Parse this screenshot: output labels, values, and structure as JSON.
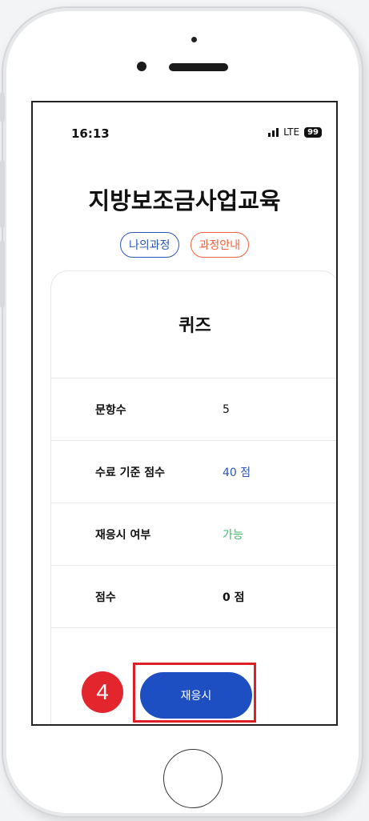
{
  "status_bar": {
    "time": "16:13",
    "network": "LTE",
    "battery": "99"
  },
  "app_title": "지방보조금사업교육",
  "nav_pills": [
    {
      "label": "나의과정",
      "color": "#2b56b8"
    },
    {
      "label": "과정안내",
      "color": "#f2603b"
    }
  ],
  "quiz": {
    "title": "퀴즈",
    "rows": [
      {
        "label": "문항수",
        "value": "5",
        "value_color": "#111111"
      },
      {
        "label": "수료 기준 점수",
        "value": "40 점",
        "value_color": "#2b56b8"
      },
      {
        "label": "재응시 여부",
        "value": "가능",
        "value_color": "#3dbb6a"
      },
      {
        "label": "점수",
        "value": "0 점",
        "value_color": "#111111"
      }
    ],
    "retry_button": "재응시"
  },
  "annotation": {
    "step_number": "4",
    "highlight_color": "#e01e26"
  },
  "colors": {
    "primary": "#1e4fc2",
    "accent_orange": "#f2603b"
  }
}
